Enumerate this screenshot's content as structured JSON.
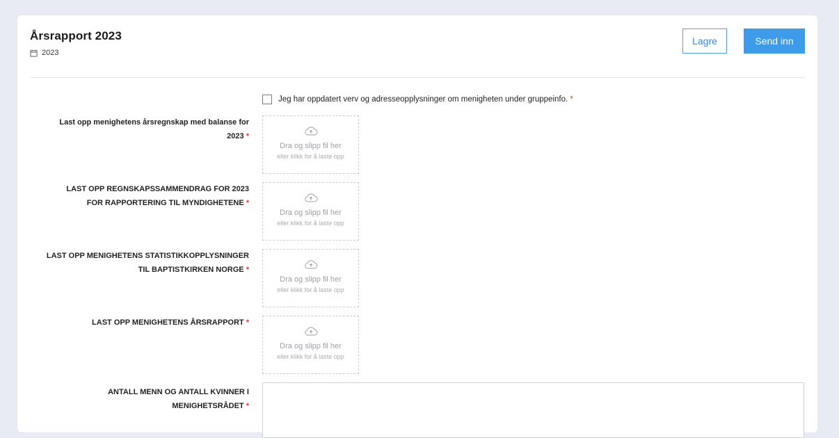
{
  "header": {
    "title": "Årsrapport 2023",
    "year": "2023"
  },
  "buttons": {
    "save": "Lagre",
    "submit": "Send inn"
  },
  "checkbox": {
    "label": "Jeg har oppdatert verv og adresseopplysninger om menigheten under gruppeinfo.",
    "required_mark": "*",
    "checked": false
  },
  "dropzone": {
    "main": "Dra og slipp fil her",
    "sub": "eller klikk for å laste opp"
  },
  "fields": [
    {
      "label_line1": "Last opp menighetens årsregnskap med balanse for",
      "label_line2": "2023",
      "required_mark": "*"
    },
    {
      "label_line1": "LAST OPP REGNSKAPSSAMMENDRAG FOR 2023",
      "label_line2": "FOR RAPPORTERING TIL MYNDIGHETENE",
      "required_mark": "*"
    },
    {
      "label_line1": "LAST OPP MENIGHETENS STATISTIKKOPPLYSNINGER",
      "label_line2": "TIL BAPTISTKIRKEN NORGE",
      "required_mark": "*"
    },
    {
      "label_line1": "",
      "label_line2": "LAST OPP MENIGHETENS ÅRSRAPPORT",
      "required_mark": "*"
    },
    {
      "label_line1": "ANTALL MENN OG ANTALL KVINNER I",
      "label_line2": "MENIGHETSRÅDET",
      "required_mark": "*"
    }
  ],
  "colors": {
    "page_background": "#e8ebf4",
    "accent": "#3d9be9",
    "required": "#e53935"
  },
  "icons": {
    "calendar": "calendar-icon",
    "upload": "cloud-upload-icon"
  }
}
